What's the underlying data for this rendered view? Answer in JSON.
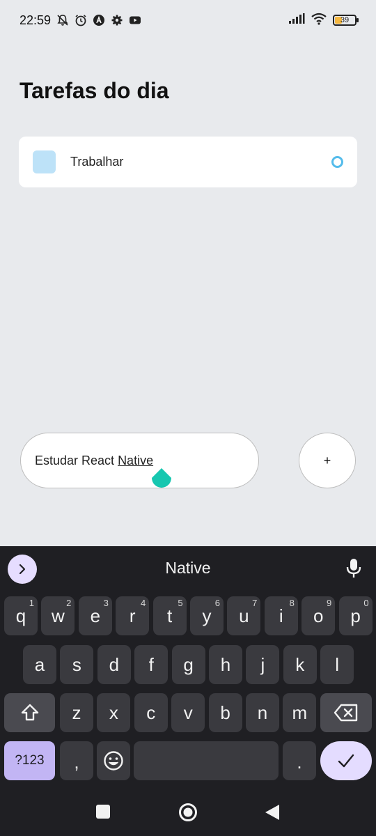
{
  "status_bar": {
    "time": "22:59",
    "battery_level": "39",
    "icons": [
      "notifications-muted-icon",
      "alarm-icon",
      "app-notification-icon",
      "settings-icon",
      "youtube-icon",
      "signal-icon",
      "wifi-icon",
      "battery-icon"
    ]
  },
  "page": {
    "title": "Tarefas do dia"
  },
  "tasks": [
    {
      "label": "Trabalhar",
      "square_color": "#BDE2F8",
      "circle_color": "#55BCEB"
    }
  ],
  "input": {
    "text_plain": "Estudar React",
    "text_composing": "Native"
  },
  "add_button": {
    "label": "+"
  },
  "keyboard": {
    "suggestion": "Native",
    "row1": [
      {
        "k": "q",
        "h": "1"
      },
      {
        "k": "w",
        "h": "2"
      },
      {
        "k": "e",
        "h": "3"
      },
      {
        "k": "r",
        "h": "4"
      },
      {
        "k": "t",
        "h": "5"
      },
      {
        "k": "y",
        "h": "6"
      },
      {
        "k": "u",
        "h": "7"
      },
      {
        "k": "i",
        "h": "8"
      },
      {
        "k": "o",
        "h": "9"
      },
      {
        "k": "p",
        "h": "0"
      }
    ],
    "row2": [
      "a",
      "s",
      "d",
      "f",
      "g",
      "h",
      "j",
      "k",
      "l"
    ],
    "row3": [
      "z",
      "x",
      "c",
      "v",
      "b",
      "n",
      "m"
    ],
    "symbols_label": "?123",
    "comma": ",",
    "period": "."
  }
}
